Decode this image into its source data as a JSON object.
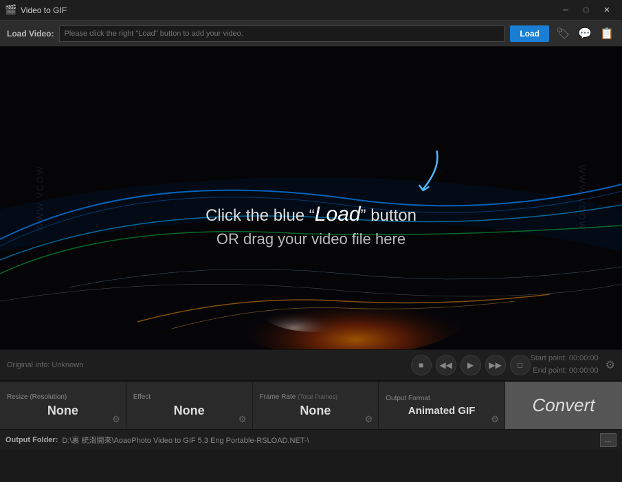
{
  "titlebar": {
    "icon": "🎬",
    "title": "Video to GIF",
    "minimize": "─",
    "maximize": "□",
    "close": "✕"
  },
  "loadbar": {
    "label": "Load Video:",
    "placeholder": "Please click the right \"Load\" button to add your video.",
    "button": "Load",
    "icon1": "🏷",
    "icon2": "💬",
    "icon3": "📋"
  },
  "video": {
    "instruction_arrow": "↙",
    "line1a": "Click the blue \"",
    "line1b": "Load",
    "line1c": "\" button",
    "line2": "OR drag your video file here",
    "watermark": "WWW.VCOW"
  },
  "controls": {
    "original_info": "Original Info: Unknown",
    "start_point": "Start point: 00:00:00",
    "end_point": "End point:  00:00:00"
  },
  "options": {
    "panels": [
      {
        "label": "Resize (Resolution)",
        "value": "None",
        "has_gear": true
      },
      {
        "label": "Effect",
        "value": "None",
        "has_gear": true
      },
      {
        "label_main": "Frame Rate",
        "label_sub": "(Total Frames)",
        "value": "None",
        "has_gear": true
      },
      {
        "label": "Output Format",
        "value": "Animated GIF",
        "has_gear": true
      }
    ],
    "convert": "Convert"
  },
  "outputbar": {
    "label": "Output Folder:",
    "path": "D:\\裏  統滑開來\\AoaoPhoto Video to GIF 5.3 Eng Portable-RSLOAD.NET-\\",
    "dots": "..."
  }
}
